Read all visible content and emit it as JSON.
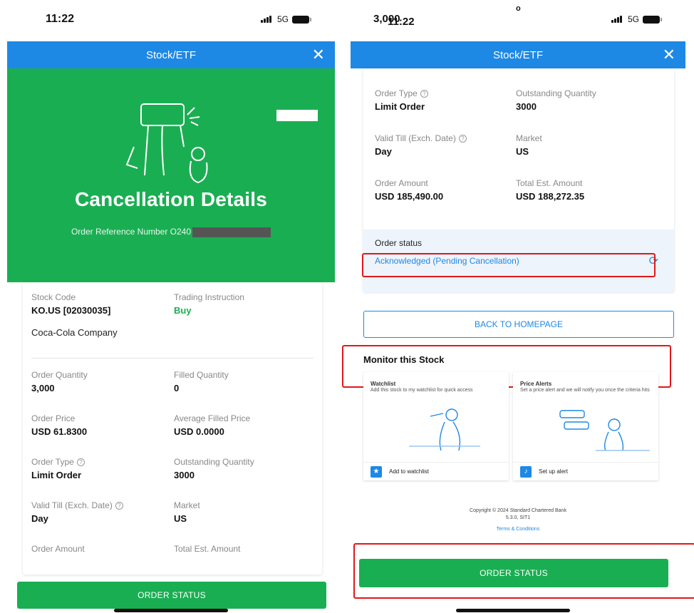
{
  "left": {
    "status": {
      "time": "11:22",
      "network": "5G"
    },
    "appbar": {
      "title": "Stock/ETF",
      "close": "✕"
    },
    "hero": {
      "title": "Cancellation Details",
      "ref_label": "Order Reference Number O240"
    },
    "fields": {
      "stock_code_label": "Stock Code",
      "stock_code": "KO.US [02030035]",
      "company": "Coca-Cola Company",
      "trading_instruction_label": "Trading Instruction",
      "trading_instruction": "Buy",
      "order_quantity_label": "Order Quantity",
      "order_quantity": "3,000",
      "filled_quantity_label": "Filled Quantity",
      "filled_quantity": "0",
      "order_price_label": "Order Price",
      "order_price": "USD 61.8300",
      "avg_filled_price_label": "Average Filled Price",
      "avg_filled_price": "USD 0.0000",
      "order_type_label": "Order Type",
      "order_type": "Limit Order",
      "outstanding_quantity_label": "Outstanding Quantity",
      "outstanding_quantity": "3000",
      "valid_till_label": "Valid Till (Exch. Date)",
      "valid_till": "Day",
      "market_label": "Market",
      "market": "US",
      "order_amount_label": "Order Amount",
      "total_est_label": "Total Est. Amount"
    },
    "button": "ORDER STATUS"
  },
  "right": {
    "status": {
      "time_prefix": "3,000",
      "time": "11:22",
      "dot": "o",
      "network": "5G"
    },
    "appbar": {
      "title": "Stock/ETF",
      "close": "✕"
    },
    "fields": {
      "order_type_label": "Order Type",
      "order_type": "Limit Order",
      "outstanding_quantity_label": "Outstanding Quantity",
      "outstanding_quantity": "3000",
      "valid_till_label": "Valid Till (Exch. Date)",
      "valid_till": "Day",
      "market_label": "Market",
      "market": "US",
      "order_amount_label": "Order Amount",
      "order_amount": "USD 185,490.00",
      "total_est_label": "Total Est. Amount",
      "total_est": "USD 188,272.35"
    },
    "order_status": {
      "label": "Order status",
      "value": "Acknowledged (Pending Cancellation)"
    },
    "back_button": "BACK TO HOMEPAGE",
    "monitor": {
      "title": "Monitor this Stock",
      "watchlist": {
        "title": "Watchlist",
        "desc": "Add this stock to my watchlist for quick access",
        "action": "Add to watchlist"
      },
      "alerts": {
        "title": "Price Alerts",
        "desc": "Set a price alert and we will notify you once the criteria hits",
        "action": "Set up alert"
      }
    },
    "footer": {
      "copyright": "Copyright © 2024 Standard Chartered Bank",
      "version": "5.3.0, SIT1",
      "terms": "Terms & Conditions"
    },
    "button": "ORDER STATUS"
  },
  "colors": {
    "green": "#1aae52",
    "blue": "#1e88e5",
    "highlight": "#e0181b"
  }
}
